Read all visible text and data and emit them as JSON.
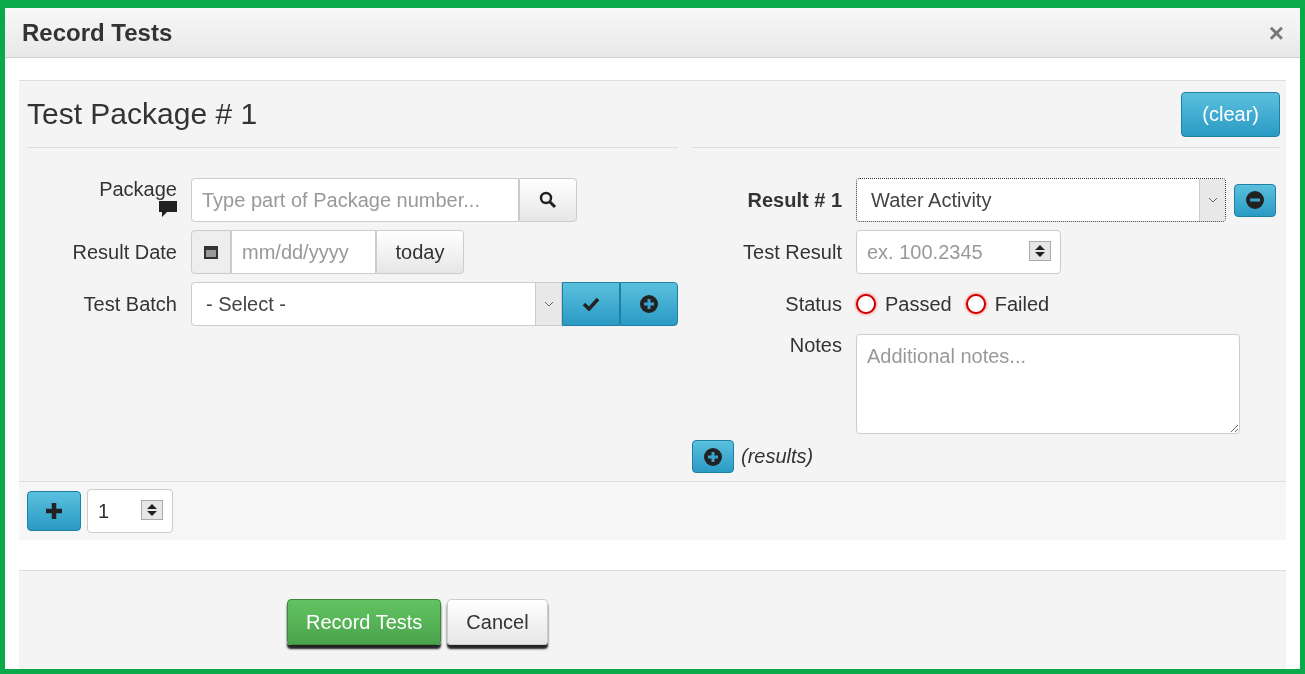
{
  "dialog": {
    "title": "Record Tests",
    "close": "×"
  },
  "package_section": {
    "title": "Test Package # 1",
    "clear_button": "(clear)",
    "package": {
      "label": "Package",
      "placeholder": "Type part of Package number..."
    },
    "result_date": {
      "label": "Result Date",
      "placeholder": "mm/dd/yyyy",
      "today_button": "today"
    },
    "test_batch": {
      "label": "Test Batch",
      "value": "- Select -"
    },
    "result": {
      "label": "Result # 1",
      "value": "Water Activity"
    },
    "test_result": {
      "label": "Test Result",
      "placeholder": "ex. 100.2345"
    },
    "status": {
      "label": "Status",
      "options": [
        {
          "label": "Passed",
          "selected": false,
          "invalid": true
        },
        {
          "label": "Failed",
          "selected": false,
          "invalid": true
        }
      ]
    },
    "notes": {
      "label": "Notes",
      "placeholder": "Additional notes..."
    },
    "add_results_label": "(results)"
  },
  "package_count": {
    "value": "1"
  },
  "footer": {
    "buttons": [
      {
        "label": "Record Tests",
        "kind": "primary"
      },
      {
        "label": "Cancel",
        "kind": "default"
      }
    ]
  }
}
